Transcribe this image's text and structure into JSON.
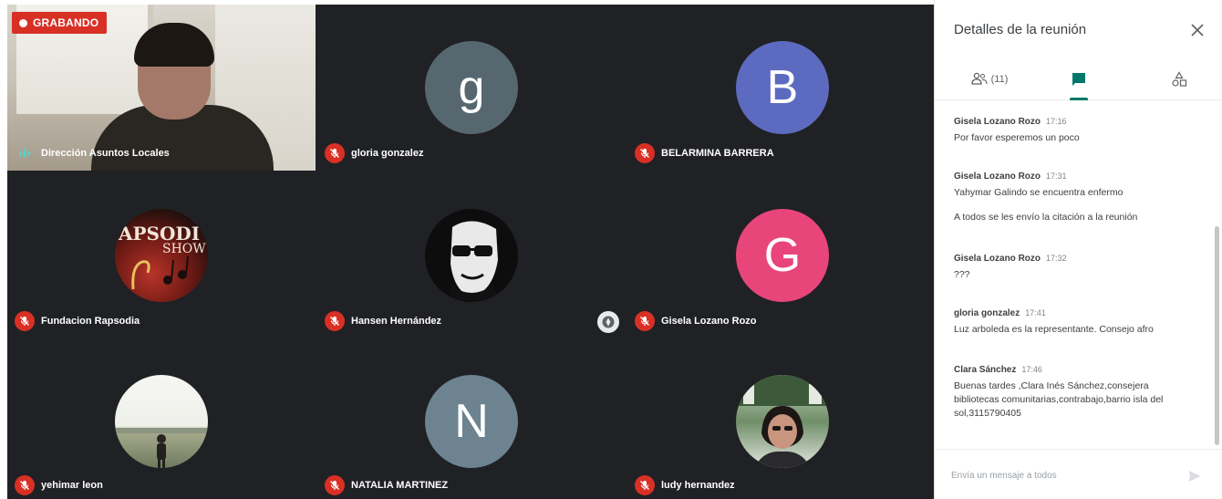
{
  "recording": {
    "label": "GRABANDO"
  },
  "participants": [
    {
      "name": "Dirección Asuntos Locales",
      "kind": "video",
      "mic": "on"
    },
    {
      "name": "gloria gonzalez",
      "kind": "initial",
      "initial": "g",
      "avatar_color": "#56676f",
      "mic": "off"
    },
    {
      "name": "BELARMINA BARRERA",
      "kind": "initial",
      "initial": "B",
      "avatar_color": "#5c6bc0",
      "mic": "off"
    },
    {
      "name": "Fundacion Rapsodia",
      "kind": "photo",
      "avatar_text_line1": "APSODI",
      "avatar_text_line2": "SHOW",
      "mic": "off"
    },
    {
      "name": "Hansen Hernández",
      "kind": "photo",
      "mic": "off"
    },
    {
      "name": "Gisela Lozano Rozo",
      "kind": "initial",
      "initial": "G",
      "avatar_color": "#e8457a",
      "mic": "off",
      "pinnable": true
    },
    {
      "name": "yehimar leon",
      "kind": "photo",
      "mic": "off"
    },
    {
      "name": "NATALIA MARTINEZ",
      "kind": "initial",
      "initial": "N",
      "avatar_color": "#6d8390",
      "mic": "off"
    },
    {
      "name": "ludy hernandez",
      "kind": "photo",
      "mic": "off"
    }
  ],
  "panel": {
    "title": "Detalles de la reunión",
    "people_count": "(11)",
    "messages": [
      {
        "sender": "Gisela Lozano Rozo",
        "time": "17:16",
        "lines": [
          "Por favor esperemos un poco"
        ]
      },
      {
        "sender": "Gisela Lozano Rozo",
        "time": "17:31",
        "lines": [
          "Yahymar Galindo se encuentra enfermo",
          "A todos se les envío la citación a la reunión"
        ]
      },
      {
        "sender": "Gisela Lozano Rozo",
        "time": "17:32",
        "lines": [
          "???"
        ]
      },
      {
        "sender": "gloria gonzalez",
        "time": "17:41",
        "lines": [
          "Luz arboleda es la representante. Consejo afro"
        ]
      },
      {
        "sender": "Clara Sánchez",
        "time": "17:46",
        "lines": [
          "Buenas tardes ,Clara Inés Sánchez,consejera bibliotecas comunitarias,contrabajo,barrio isla del sol,3115790405"
        ]
      }
    ],
    "compose_placeholder": "Envía un mensaje a todos"
  },
  "colors": {
    "tile_bg": "#202124",
    "mic_off": "#d93025",
    "accent": "#00796b"
  },
  "icons": {
    "mic_off": "mic-off-icon",
    "mic_on": "audio-level-icon",
    "close": "close-icon",
    "people": "people-icon",
    "chat": "chat-icon",
    "activities": "shapes-icon",
    "send": "send-icon",
    "pin": "pin-icon"
  }
}
